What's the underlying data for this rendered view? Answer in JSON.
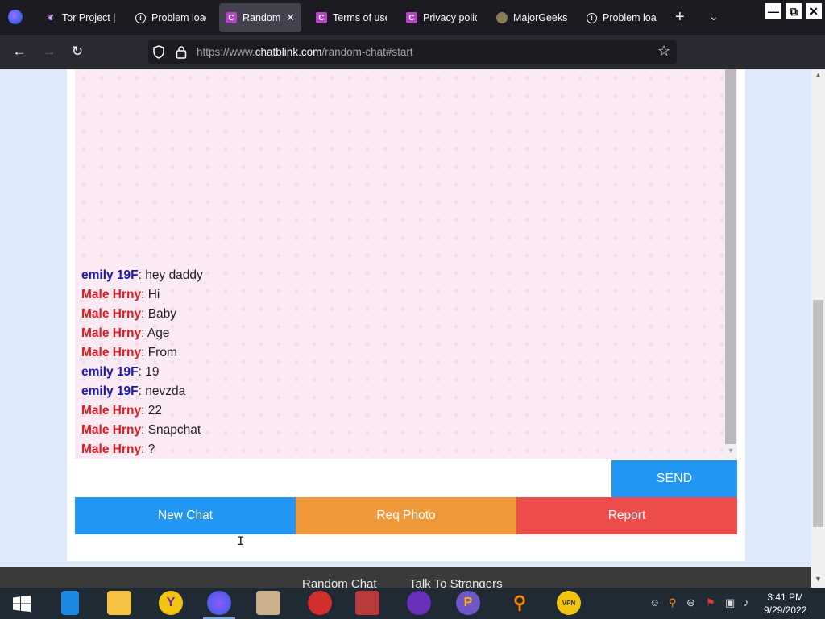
{
  "browser": {
    "tabs": [
      {
        "label": "Tor Project |",
        "icon": "tor-icon"
      },
      {
        "label": "Problem loadi",
        "icon": "info-icon"
      },
      {
        "label": "Random ch",
        "icon": "chatblink-icon",
        "active": true
      },
      {
        "label": "Terms of use",
        "icon": "chatblink-icon"
      },
      {
        "label": "Privacy polic",
        "icon": "chatblink-icon"
      },
      {
        "label": "MajorGeeks.",
        "icon": "majorgeeks-icon"
      },
      {
        "label": "Problem loa",
        "icon": "info-icon"
      }
    ],
    "url_prefix": "https://www.",
    "url_domain": "chatblink.com",
    "url_path": "/random-chat#start"
  },
  "chat": {
    "messages": [
      {
        "sender": "emily 19F",
        "type": "emily",
        "text": ": hey daddy"
      },
      {
        "sender": "Male Hrny",
        "type": "male",
        "text": ": Hi"
      },
      {
        "sender": "Male Hrny",
        "type": "male",
        "text": ": Baby"
      },
      {
        "sender": "Male Hrny",
        "type": "male",
        "text": ": Age"
      },
      {
        "sender": "Male Hrny",
        "type": "male",
        "text": ": From"
      },
      {
        "sender": "emily 19F",
        "type": "emily",
        "text": ": 19"
      },
      {
        "sender": "emily 19F",
        "type": "emily",
        "text": ": nevzda"
      },
      {
        "sender": "Male Hrny",
        "type": "male",
        "text": ": 22"
      },
      {
        "sender": "Male Hrny",
        "type": "male",
        "text": ": Snapchat"
      },
      {
        "sender": "Male Hrny",
        "type": "male",
        "text": ": ?"
      }
    ],
    "input_value": "",
    "send_label": "SEND",
    "new_chat_label": "New Chat",
    "req_photo_label": "Req Photo",
    "report_label": "Report"
  },
  "footer": {
    "link1": "Random Chat",
    "link2": "Talk To Strangers"
  },
  "taskbar": {
    "time": "3:41 PM",
    "date": "9/29/2022"
  },
  "colors": {
    "emily": "#1818b8",
    "male": "#e01a1a",
    "send": "#2196f3",
    "new_chat": "#2196f3",
    "req_photo": "#f0993b",
    "report": "#ed4c4c"
  }
}
